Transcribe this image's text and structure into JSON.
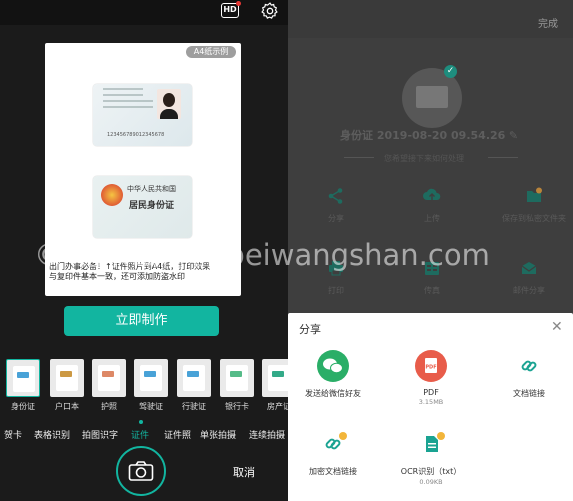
{
  "left": {
    "hd_label": "HD",
    "a4_tag": "A4纸示例",
    "id_front_num": "123456789012345678",
    "id_back_title": "中华人民共和国",
    "id_back_name": "居民身份证",
    "notice_line1": "出门办事必备！↑证件照片到A4纸，打印效果",
    "notice_line2": "与复印件基本一致，还可添加防盗水印",
    "make_button": "立即制作",
    "cards": [
      {
        "label": "身份证",
        "selected": true
      },
      {
        "label": "户口本",
        "selected": false
      },
      {
        "label": "护照",
        "selected": false
      },
      {
        "label": "驾驶证",
        "selected": false
      },
      {
        "label": "行驶证",
        "selected": false
      },
      {
        "label": "银行卡",
        "selected": false
      },
      {
        "label": "房产证",
        "selected": false
      }
    ],
    "modes": [
      "贺卡",
      "表格识别",
      "拍图识字",
      "证件",
      "证件照",
      "单张拍摄",
      "连续拍摄"
    ],
    "active_mode": "证件",
    "cancel": "取消"
  },
  "right": {
    "done": "完成",
    "doc_title": "身份证 2019-08-20 09.54.26",
    "hint": "您希望接下来如何处理",
    "actions": [
      {
        "label": "分享",
        "icon": "share-icon"
      },
      {
        "label": "上传",
        "icon": "upload-icon"
      },
      {
        "label": "保存到私密文件夹",
        "icon": "private-folder-icon"
      },
      {
        "label": "打印",
        "icon": "print-icon"
      },
      {
        "label": "传真",
        "icon": "fax-icon"
      },
      {
        "label": "邮件分享",
        "icon": "mail-icon"
      }
    ],
    "share_sheet": {
      "title": "分享",
      "items": [
        {
          "label": "发送给微信好友",
          "sub": "",
          "icon": "wechat-icon",
          "color": "#2aae67"
        },
        {
          "label": "PDF",
          "sub": "3.15MB",
          "icon": "pdf-icon",
          "color": "#e85c4a"
        },
        {
          "label": "文档链接",
          "sub": "",
          "icon": "link-icon",
          "color": "#ffffff"
        },
        {
          "label": "加密文档链接",
          "sub": "",
          "icon": "locked-link-icon",
          "color": "#ffffff"
        },
        {
          "label": "OCR识别（txt）",
          "sub": "0.09KB",
          "icon": "ocr-icon",
          "color": "#ffffff"
        }
      ]
    }
  },
  "watermark": "© 北京山博客 beiwangshan.com",
  "colors": {
    "accent": "#12b5a0",
    "teal_dark": "#1e8d7e",
    "wechat": "#2aae67",
    "pdf": "#e85c4a"
  }
}
